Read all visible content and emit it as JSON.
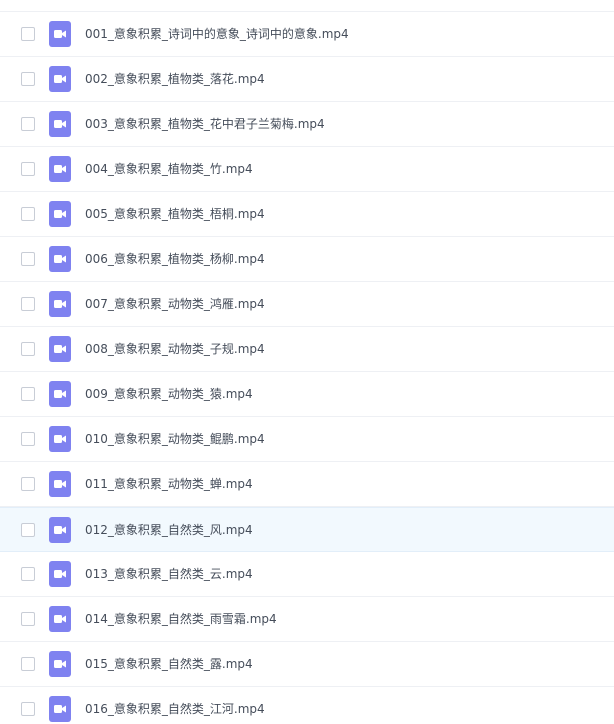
{
  "files": [
    {
      "name": "",
      "icon": "video-file-icon"
    },
    {
      "name": "001_意象积累_诗词中的意象_诗词中的意象.mp4",
      "icon": "video-file-icon"
    },
    {
      "name": "002_意象积累_植物类_落花.mp4",
      "icon": "video-file-icon"
    },
    {
      "name": "003_意象积累_植物类_花中君子兰菊梅.mp4",
      "icon": "video-file-icon"
    },
    {
      "name": "004_意象积累_植物类_竹.mp4",
      "icon": "video-file-icon"
    },
    {
      "name": "005_意象积累_植物类_梧桐.mp4",
      "icon": "video-file-icon"
    },
    {
      "name": "006_意象积累_植物类_杨柳.mp4",
      "icon": "video-file-icon"
    },
    {
      "name": "007_意象积累_动物类_鸿雁.mp4",
      "icon": "video-file-icon"
    },
    {
      "name": "008_意象积累_动物类_子规.mp4",
      "icon": "video-file-icon"
    },
    {
      "name": "009_意象积累_动物类_猿.mp4",
      "icon": "video-file-icon"
    },
    {
      "name": "010_意象积累_动物类_鲲鹏.mp4",
      "icon": "video-file-icon"
    },
    {
      "name": "011_意象积累_动物类_蝉.mp4",
      "icon": "video-file-icon"
    },
    {
      "name": "012_意象积累_自然类_风.mp4",
      "icon": "video-file-icon"
    },
    {
      "name": "013_意象积累_自然类_云.mp4",
      "icon": "video-file-icon"
    },
    {
      "name": "014_意象积累_自然类_雨雪霜.mp4",
      "icon": "video-file-icon"
    },
    {
      "name": "015_意象积累_自然类_露.mp4",
      "icon": "video-file-icon"
    },
    {
      "name": "016_意象积累_自然类_江河.mp4",
      "icon": "video-file-icon"
    }
  ],
  "colors": {
    "icon_purple": "#7f82f0",
    "hover_row": "#f2f9fe",
    "text": "#454d5a",
    "divider": "#eef0f4"
  }
}
